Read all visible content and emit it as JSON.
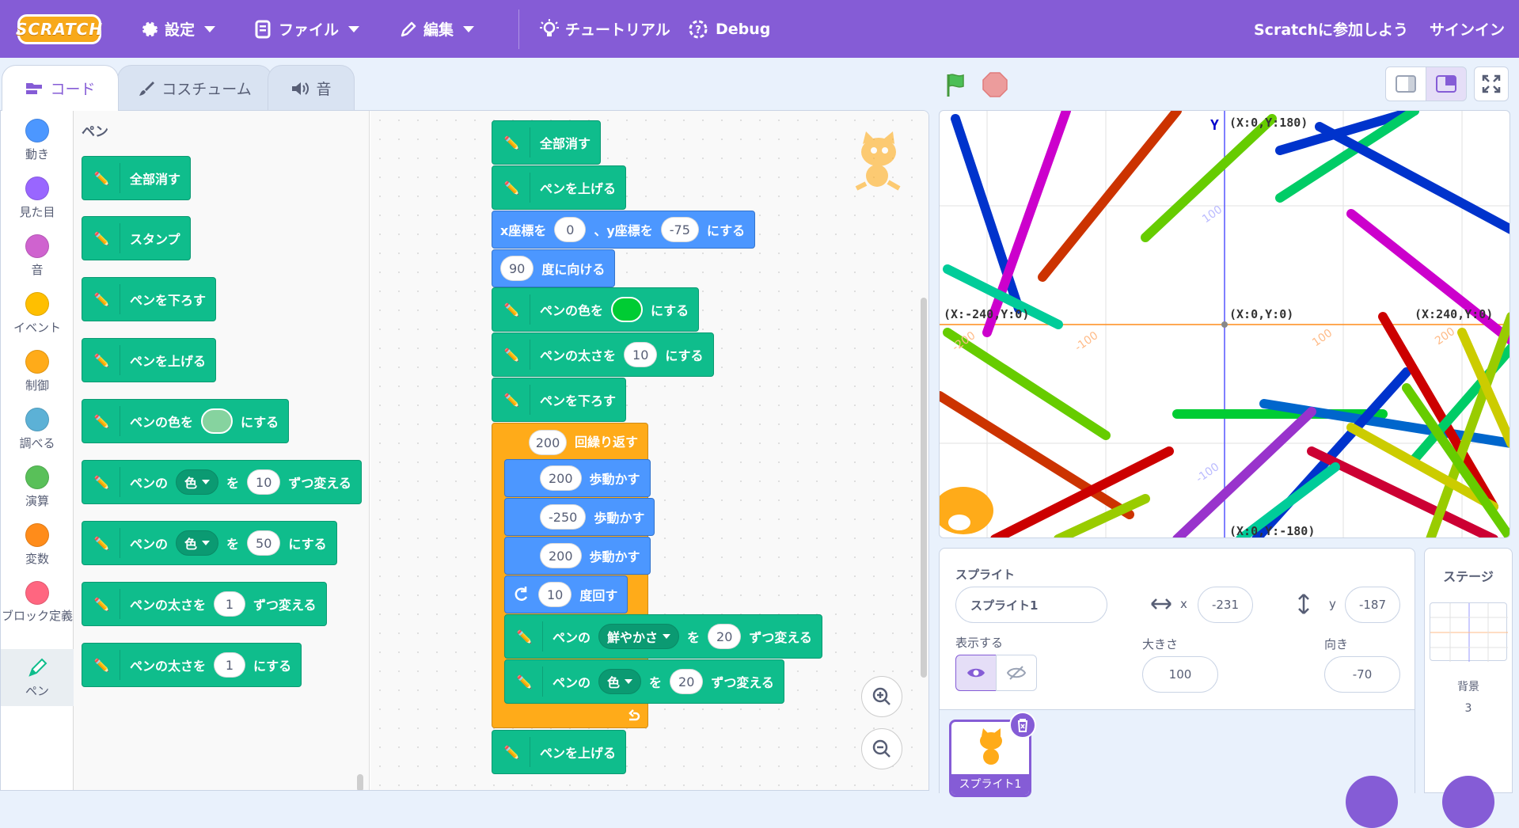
{
  "menubar": {
    "logo_text": "SCRATCH",
    "settings": "設定",
    "file": "ファイル",
    "edit": "編集",
    "tutorials": "チュートリアル",
    "debug": "Debug",
    "join": "Scratchに参加しよう",
    "signin": "サインイン"
  },
  "tabs": {
    "code": "コード",
    "costumes": "コスチューム",
    "sounds": "音"
  },
  "categories": [
    {
      "label": "動き",
      "color": "#4c97ff"
    },
    {
      "label": "見た目",
      "color": "#9966ff"
    },
    {
      "label": "音",
      "color": "#cf63cf"
    },
    {
      "label": "イベント",
      "color": "#ffbf00"
    },
    {
      "label": "制御",
      "color": "#ffab19"
    },
    {
      "label": "調べる",
      "color": "#5cb1d6"
    },
    {
      "label": "演算",
      "color": "#59c059"
    },
    {
      "label": "変数",
      "color": "#ff8c1a"
    },
    {
      "label": "ブロック定義",
      "color": "#ff6680"
    },
    {
      "label": "ペン",
      "color": "#0fbd8c"
    }
  ],
  "flyout": {
    "heading": "ペン",
    "clear": "全部消す",
    "stamp": "スタンプ",
    "pen_down": "ペンを下ろす",
    "pen_up": "ペンを上げる",
    "set_color_a": "ペンの色を",
    "set_color_b": "にする",
    "change_param_a": "ペンの",
    "change_param_dd": "色",
    "change_param_b": "を",
    "change_param_val": "10",
    "change_param_c": "ずつ変える",
    "set_param_a": "ペンの",
    "set_param_dd": "色",
    "set_param_b": "を",
    "set_param_val": "50",
    "set_param_c": "にする",
    "change_size_a": "ペンの太さを",
    "change_size_val": "1",
    "change_size_b": "ずつ変える",
    "set_size_a": "ペンの太さを",
    "set_size_val": "1",
    "set_size_b": "にする",
    "swatch_color": "#86d39f"
  },
  "script": {
    "clear": "全部消す",
    "pen_up1": "ペンを上げる",
    "goto_a": "x座標を",
    "goto_x": "0",
    "goto_b": "、y座標を",
    "goto_y": "-75",
    "goto_c": "にする",
    "point_val": "90",
    "point_label": "度に向ける",
    "color_a": "ペンの色を",
    "color_b": "にする",
    "color_value": "#00cc33",
    "size_a": "ペンの太さを",
    "size_val": "10",
    "size_b": "にする",
    "pen_down": "ペンを下ろす",
    "repeat_val": "200",
    "repeat_label": "回繰り返す",
    "move1_val": "200",
    "move_label": "歩動かす",
    "move2_val": "-250",
    "move3_val": "200",
    "turn_val": "10",
    "turn_label": "度回す",
    "chg1_a": "ペンの",
    "chg1_dd": "鮮やかさ",
    "chg1_b": "を",
    "chg1_val": "20",
    "chg1_c": "ずつ変える",
    "chg2_a": "ペンの",
    "chg2_dd": "色",
    "chg2_b": "を",
    "chg2_val": "20",
    "chg2_c": "ずつ変える",
    "pen_up2": "ペンを上げる"
  },
  "stage": {
    "label_top": "(X:0,Y:180)",
    "label_center": "(X:0,Y:0)",
    "label_right": "(X:240,Y:0)",
    "label_left": "(X:-240,Y:0)",
    "label_bottom": "(X:0,Y:-180)",
    "axis_y": "Y",
    "tick_100": "100",
    "tick_200": "200",
    "tick_m100": "-100",
    "tick_m200": "-200"
  },
  "sprite_info": {
    "sprite_label": "スプライト",
    "sprite_name": "スプライト1",
    "x_label": "x",
    "x_value": "-231",
    "y_label": "y",
    "y_value": "-187",
    "show_label": "表示する",
    "size_label": "大きさ",
    "size_value": "100",
    "direction_label": "向き",
    "direction_value": "-70",
    "thumb_name": "スプライト1"
  },
  "stage_panel": {
    "title": "ステージ",
    "backdrop_label": "背景",
    "backdrop_count": "3"
  }
}
